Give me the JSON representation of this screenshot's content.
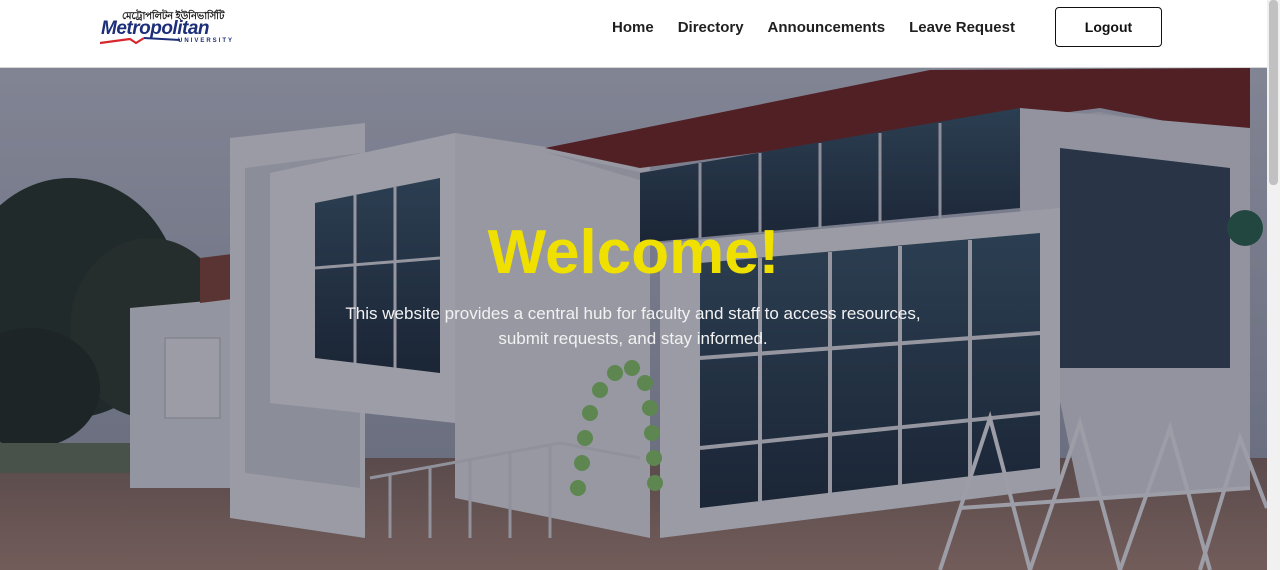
{
  "brand": {
    "bengali_name": "মেট্রোপলিটন ইউনিভার্সিটি",
    "name": "Metropolitan",
    "subtitle": "UNIVERSITY",
    "colors": {
      "navy": "#1d2f7a",
      "red": "#d8262d"
    }
  },
  "nav": {
    "links": [
      {
        "label": "Home"
      },
      {
        "label": "Directory"
      },
      {
        "label": "Announcements"
      },
      {
        "label": "Leave Request"
      }
    ],
    "logout_label": "Logout"
  },
  "hero": {
    "title": "Welcome!",
    "description": "This website provides a central hub for faculty and staff to access resources, submit requests, and stay informed.",
    "title_color": "#f0e000",
    "background": "campus-building-photo"
  }
}
